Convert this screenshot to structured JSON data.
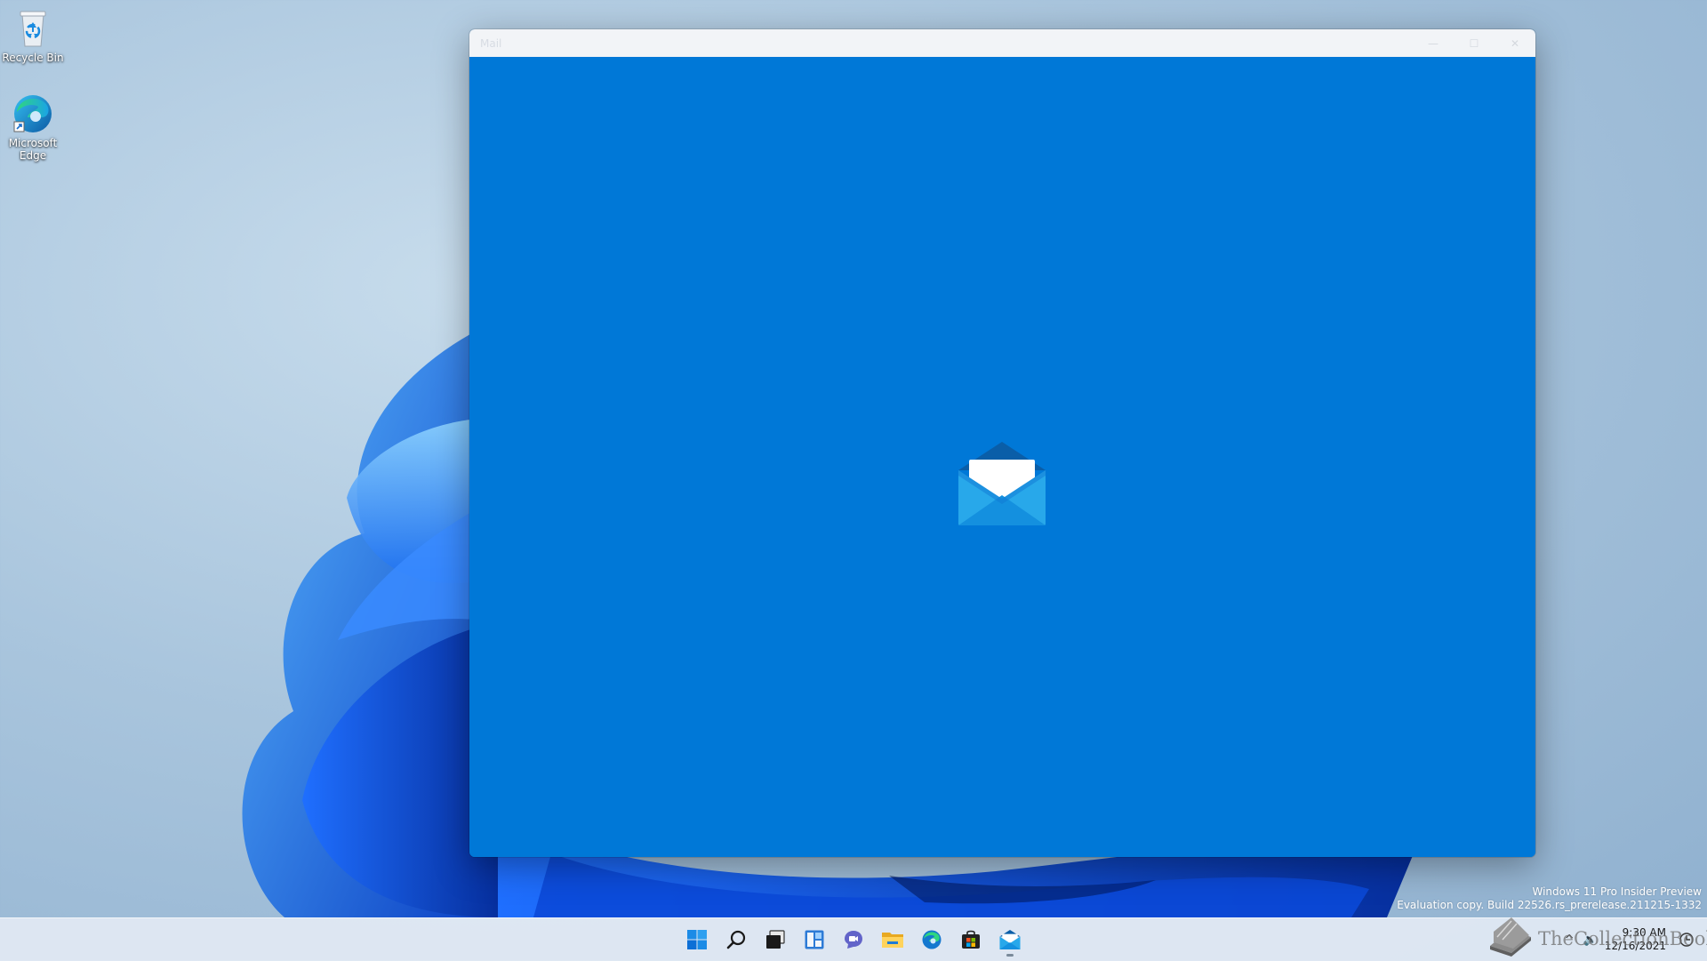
{
  "desktop": {
    "icons": [
      {
        "label": "Recycle Bin",
        "icon": "recycle-bin-icon"
      },
      {
        "label": "Microsoft Edge",
        "icon": "edge-icon"
      }
    ]
  },
  "window": {
    "title": "Mail",
    "controls": {
      "minimize": "—",
      "maximize": "☐",
      "close": "✕"
    },
    "background": "#0078d7",
    "splash_icon": "mail-envelope-icon"
  },
  "watermark": {
    "line1": "Windows 11 Pro Insider Preview",
    "line2": "Evaluation copy. Build 22526.rs_prerelease.211215-1332"
  },
  "taskbar": {
    "apps": [
      "start-icon",
      "search-icon",
      "task-view-icon",
      "widgets-icon",
      "teams-chat-icon",
      "file-explorer-icon",
      "edge-icon",
      "store-icon",
      "mail-icon"
    ],
    "tray": {
      "overflow": "^",
      "volume": "🔈"
    },
    "clock": {
      "time": "9:30 AM",
      "date": "12/16/2021"
    }
  },
  "brand_watermark": {
    "text": "TheCollectionBook"
  },
  "colors": {
    "accent": "#0078d7",
    "taskbar": "#e2eaf4"
  }
}
